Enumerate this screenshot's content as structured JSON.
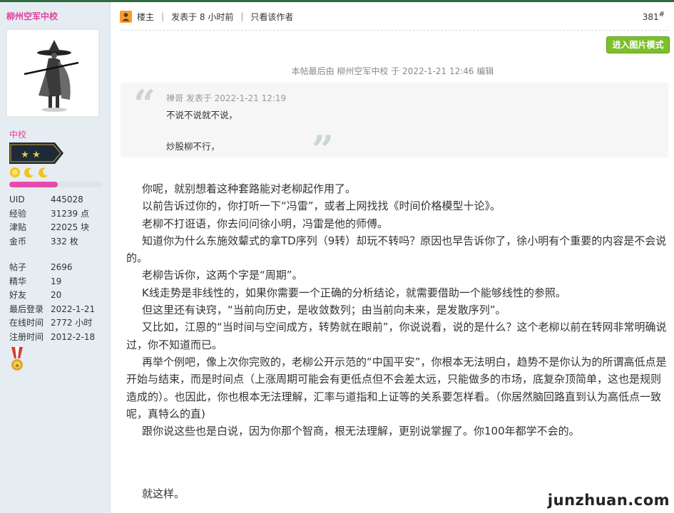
{
  "author": {
    "name": "柳州空军中校",
    "rank": "中校",
    "progress": 0.52,
    "stats": [
      {
        "k": "UID",
        "v": "445028"
      },
      {
        "k": "经验",
        "v": "31239 点"
      },
      {
        "k": "津贴",
        "v": "22025 块"
      },
      {
        "k": "金币",
        "v": "332 枚"
      }
    ],
    "stats2": [
      {
        "k": "帖子",
        "v": "2696"
      },
      {
        "k": "精华",
        "v": "19"
      },
      {
        "k": "好友",
        "v": "20"
      },
      {
        "k": "最后登录",
        "v": "2022-1-21"
      },
      {
        "k": "在线时间",
        "v": "2772 小时"
      },
      {
        "k": "注册时间",
        "v": "2012-2-18"
      }
    ]
  },
  "post": {
    "owner_label": "楼主",
    "posted": "发表于 8 小时前",
    "only_author": "只看该作者",
    "floor": "381",
    "floor_sup": "#",
    "image_mode_button": "进入图片模式",
    "edit_note": "本帖最后由 柳州空军中校 于 2022-1-21 12:46 编辑"
  },
  "quote": {
    "author_line": "禅哥 发表于 2022-1-21 12:19",
    "line1": "不说不说就不说，",
    "line2": "炒股柳不行，"
  },
  "body": {
    "paragraphs": [
      "你呢，就别想着这种套路能对老柳起作用了。",
      "以前告诉过你的，你打听一下“冯雷”，或者上网找找《时间价格模型十论》。",
      "老柳不打诳语，你去问问徐小明，冯雷是他的师傅。",
      "知道你为什么东施效颦式的拿TD序列（9转）却玩不转吗？原因也早告诉你了，徐小明有个重要的内容是不会说的。",
      "老柳告诉你，这两个字是“周期”。",
      "K线走势是非线性的，如果你需要一个正确的分析结论，就需要借助一个能够线性的参照。",
      "但这里还有诀窍，“当前向历史，是收敛数列；由当前向未来，是发散序列”。",
      "又比如，江恩的“当时间与空间成方，转势就在眼前”，你说说看，说的是什么？这个老柳以前在转网非常明确说过，你不知道而已。",
      "再举个例吧，像上次你完败的，老柳公开示范的“中国平安”，你根本无法明白，趋势不是你认为的所谓高低点是开始与结束，而是时间点（上涨周期可能会有更低点但不会差太远，只能做多的市场，底复杂顶简单，这也是规则造成的）。也因此，你也根本无法理解，汇率与道指和上证等的关系要怎样看。（你居然脑回路直到认为高低点一致呢，真特么的直)",
      "跟你说这些也是白说，因为你那个智商，根无法理解，更别说掌握了。你100年都学不会的。"
    ],
    "ending": "就这样。"
  },
  "watermark": "junzhuan.com"
}
